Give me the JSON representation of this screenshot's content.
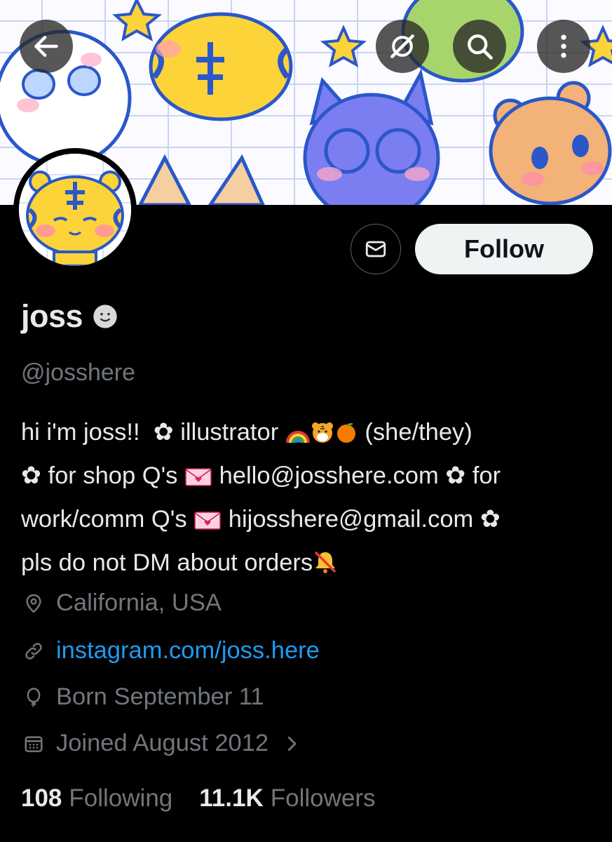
{
  "profile": {
    "display_name": "joss",
    "handle": "@josshere",
    "bio": {
      "l1_a": "hi i'm joss!!",
      "flower": "✿",
      "l1_b": "illustrator",
      "l1_c": "(she/they)",
      "l2_a": "for shop Q's",
      "l2_email": "hello@josshere.com",
      "l2_b": "for",
      "l3_a": "work/comm Q's",
      "l3_email": "hijosshere@gmail.com",
      "l4_a": "pls do not DM about orders"
    },
    "location": "California, USA",
    "website": "instagram.com/joss.here",
    "birthday": "Born September 11",
    "joined": "Joined August 2012",
    "following_count": "108",
    "following_label": "Following",
    "followers_count": "11.1K",
    "followers_label": "Followers"
  },
  "actions": {
    "follow_label": "Follow"
  },
  "icons": {
    "back": "arrow-left-icon",
    "grok": "grok-icon",
    "search": "search-icon",
    "more": "more-vertical-icon",
    "message": "envelope-icon",
    "location": "location-pin-icon",
    "link": "link-icon",
    "birthday": "balloon-icon",
    "joined": "calendar-icon",
    "verified": "smiley-icon"
  },
  "colors": {
    "background": "#000000",
    "text_primary": "#e7e9ea",
    "text_secondary": "#71767b",
    "link": "#1d9bf0",
    "follow_bg": "#eff3f4"
  }
}
